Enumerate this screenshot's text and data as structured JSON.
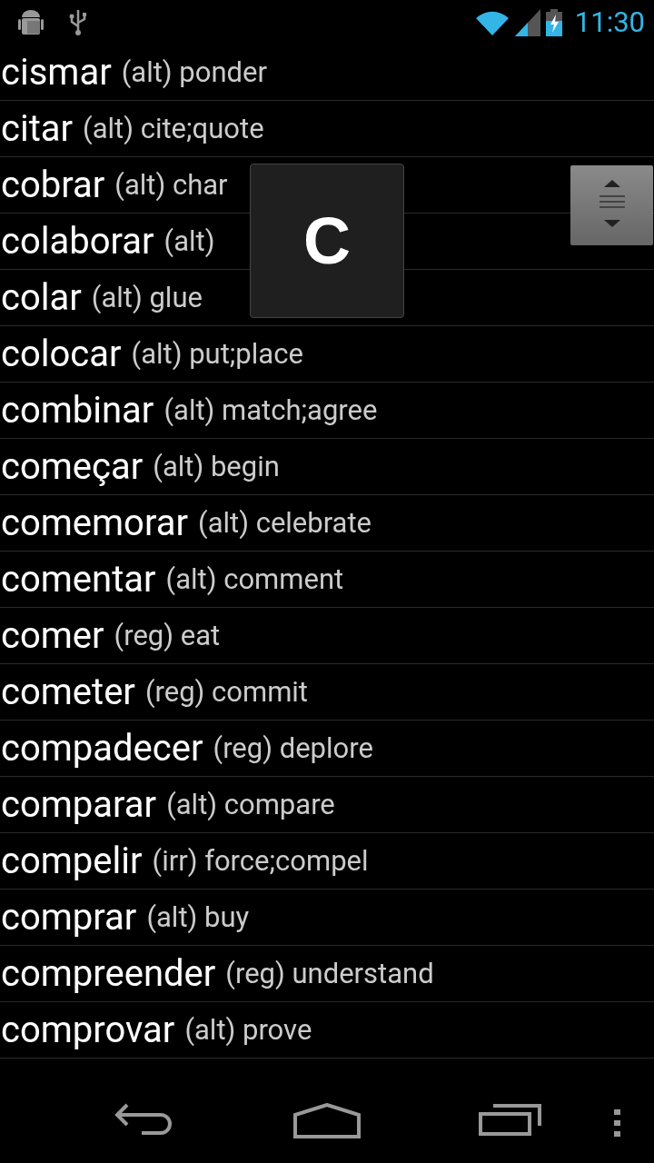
{
  "status_bar": {
    "time": "11:30"
  },
  "verbs": [
    {
      "verb": "cismar",
      "type": "(alt)",
      "meaning": "ponder"
    },
    {
      "verb": "citar",
      "type": "(alt)",
      "meaning": "cite;quote"
    },
    {
      "verb": "cobrar",
      "type": "(alt)",
      "meaning": "char"
    },
    {
      "verb": "colaborar",
      "type": "(alt)"
    },
    {
      "verb": "colar",
      "type": "(alt)",
      "meaning": "glue"
    },
    {
      "verb": "colocar",
      "type": "(alt)",
      "meaning": "put;place"
    },
    {
      "verb": "combinar",
      "type": "(alt)",
      "meaning": "match;agree"
    },
    {
      "verb": "começar",
      "type": "(alt)",
      "meaning": "begin"
    },
    {
      "verb": "comemorar",
      "type": "(alt)",
      "meaning": "celebrate"
    },
    {
      "verb": "comentar",
      "type": "(alt)",
      "meaning": "comment"
    },
    {
      "verb": "comer",
      "type": "(reg)",
      "meaning": "eat"
    },
    {
      "verb": "cometer",
      "type": "(reg)",
      "meaning": "commit"
    },
    {
      "verb": "compadecer",
      "type": "(reg)",
      "meaning": "deplore"
    },
    {
      "verb": "comparar",
      "type": "(alt)",
      "meaning": "compare"
    },
    {
      "verb": "compelir",
      "type": "(irr)",
      "meaning": "force;compel"
    },
    {
      "verb": "comprar",
      "type": "(alt)",
      "meaning": "buy"
    },
    {
      "verb": "compreender",
      "type": "(reg)",
      "meaning": "understand"
    },
    {
      "verb": "comprovar",
      "type": "(alt)",
      "meaning": "prove"
    }
  ],
  "fast_scroll": {
    "letter": "C"
  }
}
